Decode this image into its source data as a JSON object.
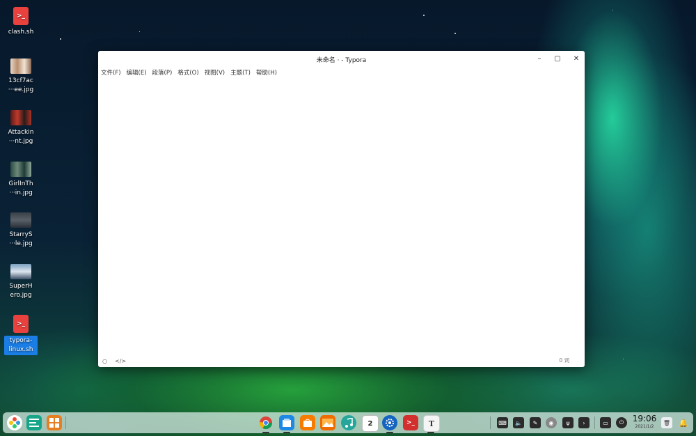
{
  "desktop": {
    "icons": [
      {
        "label": "clash.sh",
        "kind": "script"
      },
      {
        "label": "13cf7ac\n···ee.jpg",
        "kind": "image"
      },
      {
        "label": "Attackin\n···nt.jpg",
        "kind": "image"
      },
      {
        "label": "GirlInTh\n···in.jpg",
        "kind": "image"
      },
      {
        "label": "StarryS\n···le.jpg",
        "kind": "image"
      },
      {
        "label": "SuperH\nero.jpg",
        "kind": "image"
      },
      {
        "label": "typora-\nlinux.sh",
        "kind": "script",
        "selected": true
      }
    ]
  },
  "window": {
    "title": "未命名 · - Typora",
    "controls": {
      "minimize": "–",
      "maximize": "▢",
      "close": "✕"
    },
    "menu": [
      "文件(F)",
      "编辑(E)",
      "段落(P)",
      "格式(O)",
      "视图(V)",
      "主题(T)",
      "帮助(H)"
    ],
    "status": {
      "outline_icon": "○",
      "source_icon": "</>",
      "word_count": "0 词"
    }
  },
  "dock": {
    "launcher_icon": "launcher-icon",
    "apps": [
      "chrome",
      "deepin-store",
      "app-store",
      "image-viewer",
      "music",
      "calendar",
      "settings",
      "terminal",
      "typora"
    ],
    "calendar_day": "2",
    "clock": {
      "time": "19:06",
      "date": "2021/1/2"
    }
  },
  "colors": {
    "accent": "#1a7ee6",
    "script_icon": "#e8413e"
  }
}
